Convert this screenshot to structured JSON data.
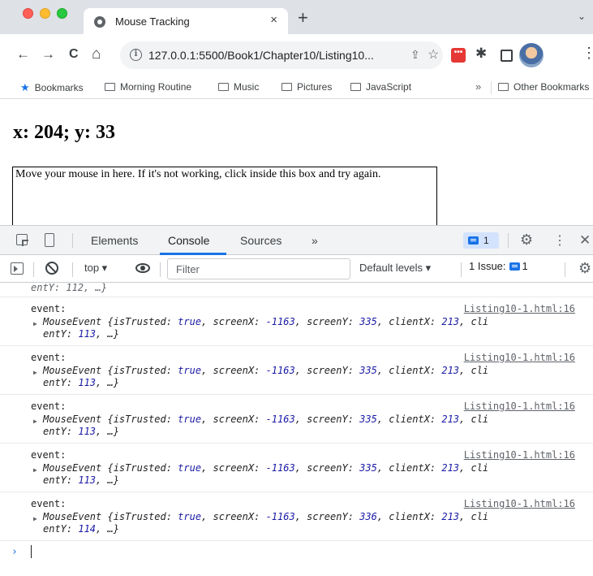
{
  "tab": {
    "title": "Mouse Tracking",
    "close": "×",
    "new_tab": "+",
    "tab_search": "⌄"
  },
  "toolbar": {
    "back": "←",
    "forward": "→",
    "reload": "C",
    "home": "⌂",
    "url": "127.0.0.1:5500/Book1/Chapter10/Listing10...",
    "info": "i",
    "share": "⇪",
    "star": "☆",
    "ext_badge": "•••",
    "menu": "⋮"
  },
  "bookmarks": {
    "items": [
      "Bookmarks",
      "Morning Routine",
      "Music",
      "Pictures",
      "JavaScript"
    ],
    "more": "»",
    "other": "Other Bookmarks"
  },
  "page": {
    "coords": "x: 204; y: 33",
    "box_text": "Move your mouse in here. If it's not working, click inside this box and try again."
  },
  "devtools": {
    "tabs": [
      "Elements",
      "Console",
      "Sources"
    ],
    "more_tabs": "»",
    "active_tab": "Console",
    "messages_count": "1",
    "gear": "⚙",
    "menu": "⋮",
    "close": "✕",
    "context": "top ▾",
    "filter_placeholder": "Filter",
    "levels": "Default levels ▾",
    "issues_label": "1 Issue:",
    "issues_count": "1"
  },
  "console": {
    "partial_top": "entY: 112, …}",
    "entries": [
      {
        "label": "event:",
        "source": "Listing10-1.html:16",
        "screenX": "-1163",
        "screenY": "335",
        "clientX": "213",
        "clientY": "113"
      },
      {
        "label": "event:",
        "source": "Listing10-1.html:16",
        "screenX": "-1163",
        "screenY": "335",
        "clientX": "213",
        "clientY": "113"
      },
      {
        "label": "event:",
        "source": "Listing10-1.html:16",
        "screenX": "-1163",
        "screenY": "335",
        "clientX": "213",
        "clientY": "113"
      },
      {
        "label": "event:",
        "source": "Listing10-1.html:16",
        "screenX": "-1163",
        "screenY": "335",
        "clientX": "213",
        "clientY": "113"
      },
      {
        "label": "event:",
        "source": "Listing10-1.html:16",
        "screenX": "-1163",
        "screenY": "336",
        "clientX": "213",
        "clientY": "114"
      }
    ],
    "object_type": "MouseEvent",
    "is_trusted": "true",
    "prompt": "›"
  },
  "colors": {
    "accent": "#1a73e8",
    "tabstrip": "#dee1e6",
    "number": "#1a1aa6"
  }
}
